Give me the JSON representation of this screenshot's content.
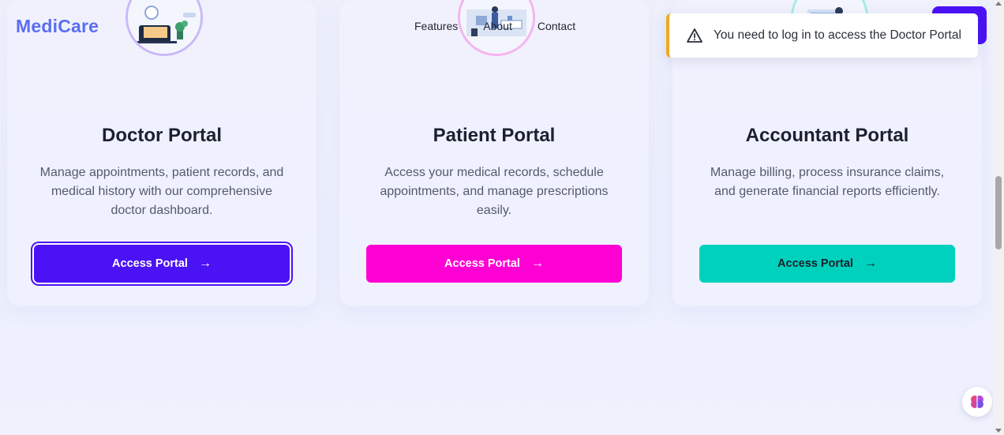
{
  "header": {
    "logo": "MediCare",
    "nav": [
      "Features",
      "About",
      "Contact"
    ]
  },
  "toast": {
    "message": "You need to log in to access the Doctor Portal",
    "icon": "warning-icon",
    "accent": "#f0a81e"
  },
  "portals": [
    {
      "title": "Doctor Portal",
      "description": "Manage appointments, patient records, and medical history with our comprehensive doctor dashboard.",
      "button_label": "Access Portal",
      "button_color": "#4a12f5",
      "ring_color": "#c9b8fb"
    },
    {
      "title": "Patient Portal",
      "description": "Access your medical records, schedule appointments, and manage prescriptions easily.",
      "button_label": "Access Portal",
      "button_color": "#ff00d4",
      "ring_color": "#f5b4ee"
    },
    {
      "title": "Accountant Portal",
      "description": "Manage billing, process insurance claims, and generate financial reports efficiently.",
      "button_label": "Access Portal",
      "button_color": "#00d1bd",
      "ring_color": "#a5ece4"
    }
  ],
  "widget": {
    "icon": "brain-icon"
  }
}
